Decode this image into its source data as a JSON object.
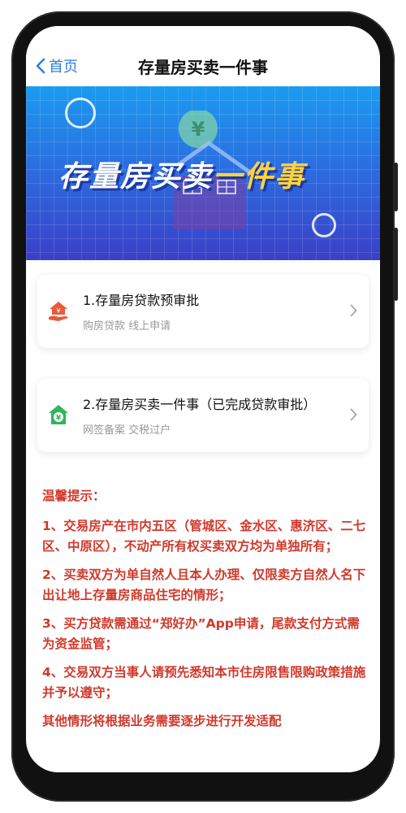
{
  "navbar": {
    "back_label": "首页",
    "title": "存量房买卖一件事"
  },
  "banner": {
    "title_main": "存量房买卖",
    "title_highlight": "一件事"
  },
  "cards": [
    {
      "title": "1.存量房贷款预审批",
      "subtitle": "购房贷款 线上申请",
      "icon": "house-hand-icon",
      "icon_color": "#e85a3c"
    },
    {
      "title": "2.存量房买卖一件事（已完成贷款审批）",
      "subtitle": "网签备案 交税过户",
      "icon": "house-yen-icon",
      "icon_color": "#2fb65c"
    }
  ],
  "notice": {
    "heading": "温馨提示：",
    "items": [
      "1、交易房产在市内五区（管城区、金水区、惠济区、二七区、中原区），不动产所有权买卖双方均为单独所有；",
      "2、买卖双方为单自然人且本人办理、仅限卖方自然人名下出让地上存量房商品住宅的情形；",
      "3、买方贷款需通过“郑好办”App申请，尾款支付方式需为资金监管；",
      "4、交易双方当事人请预先悉知本市住房限售限购政策措施并予以遵守；"
    ],
    "footer": "其他情形将根据业务需要逐步进行开发适配"
  },
  "colors": {
    "accent_blue": "#2f7ee6",
    "notice_red": "#d0392b",
    "banner_highlight": "#ffd33d"
  }
}
